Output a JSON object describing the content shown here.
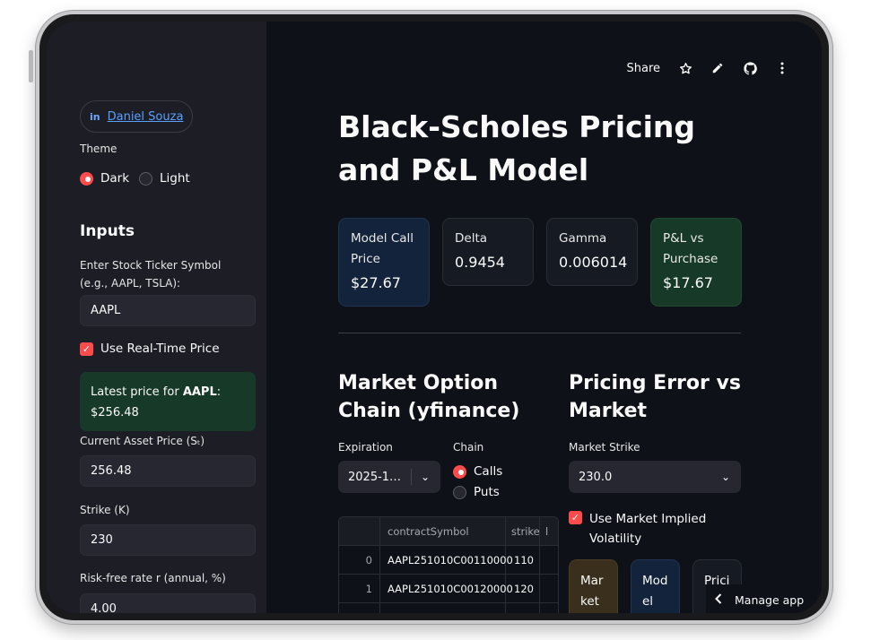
{
  "header": {
    "share_label": "Share",
    "icons": [
      "star-icon",
      "pencil-icon",
      "github-icon",
      "more-vertical-icon"
    ]
  },
  "sidebar": {
    "linkedin": {
      "icon": "in",
      "name": "Daniel Souza"
    },
    "theme_label": "Theme",
    "theme_options": [
      {
        "label": "Dark",
        "selected": true
      },
      {
        "label": "Light",
        "selected": false
      }
    ],
    "inputs_title": "Inputs",
    "ticker_label": "Enter Stock Ticker Symbol (e.g., AAPL, TSLA):",
    "ticker_value": "AAPL",
    "realtime_label": "Use Real-Time Price",
    "realtime_checked": true,
    "latest_prefix": "Latest price for ",
    "latest_ticker": "AAPL",
    "latest_suffix": ":",
    "latest_price": "$256.48",
    "asset_price_label": "Current Asset Price (Sₜ)",
    "asset_price_value": "256.48",
    "strike_label": "Strike (K)",
    "strike_value": "230",
    "rate_label": "Risk-free rate r (annual, %)",
    "rate_value": "4.00"
  },
  "main": {
    "title": "Black-Scholes Pricing and P&L Model",
    "metrics": [
      {
        "label": "Model Call Price",
        "value": "$27.67",
        "bg": "#13233b"
      },
      {
        "label": "Delta",
        "value": "0.9454",
        "bg": "#161a22"
      },
      {
        "label": "Gamma",
        "value": "0.006014",
        "bg": "#161a22"
      },
      {
        "label": "P&L vs Purchase",
        "value": "$17.67",
        "bg": "#173928"
      }
    ],
    "option_chain": {
      "title": "Market Option Chain (yfinance)",
      "expiration_label": "Expiration",
      "expiration_value": "2025-1…",
      "chain_label": "Chain",
      "chain_options": [
        {
          "label": "Calls",
          "selected": true
        },
        {
          "label": "Puts",
          "selected": false
        }
      ],
      "columns": [
        "",
        "contractSymbol",
        "strike",
        "l"
      ],
      "rows": [
        {
          "index": "0",
          "contractSymbol": "AAPL251010C00110000",
          "strike": "110"
        },
        {
          "index": "1",
          "contractSymbol": "AAPL251010C00120000",
          "strike": "120"
        }
      ]
    },
    "pricing_error": {
      "title": "Pricing Error vs Market",
      "strike_label": "Market Strike",
      "strike_value": "230.0",
      "implied_vol_label": "Use Market Implied Volatility",
      "implied_vol_checked": true,
      "mini_metrics": [
        {
          "text": "Mar ket",
          "bg": "#3a2f1c"
        },
        {
          "text": "Mod el",
          "bg": "#13233b"
        },
        {
          "text": "Prici",
          "bg": "#161a22"
        }
      ]
    },
    "manage_app_label": "Manage app"
  }
}
